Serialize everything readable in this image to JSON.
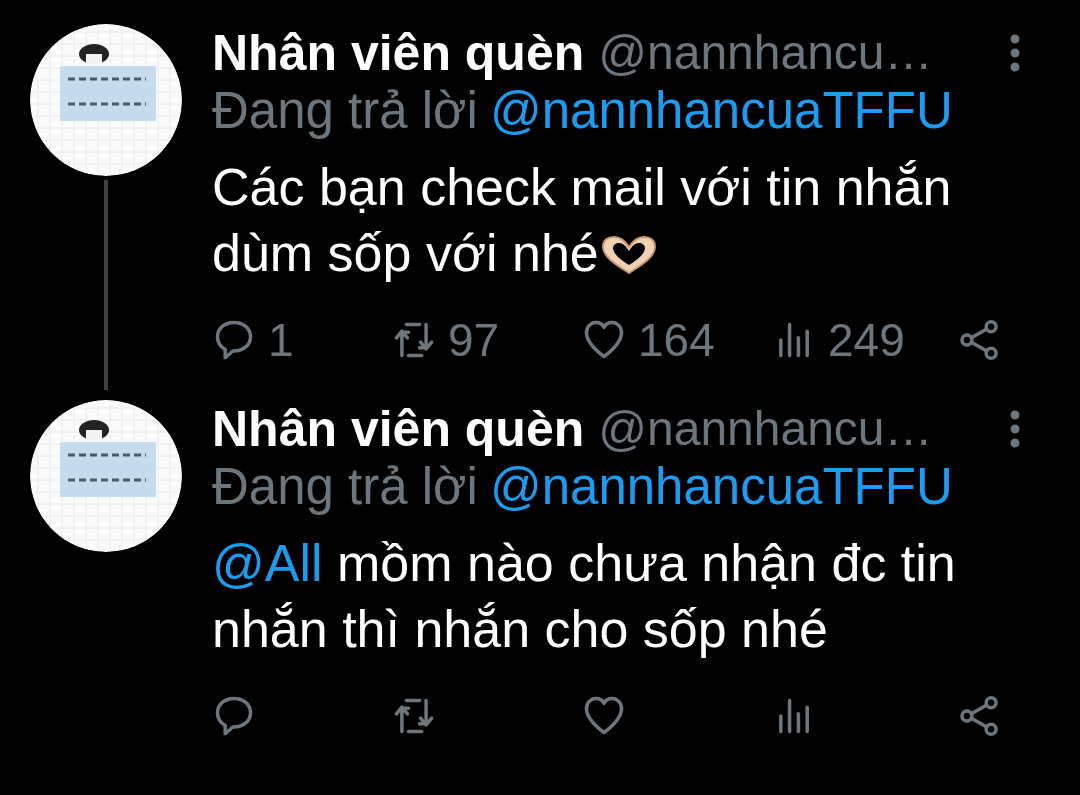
{
  "tweets": [
    {
      "name": "Nhân viên quèn",
      "handle": "@nannhancu…",
      "reply_prefix": "Đang trả lời",
      "reply_to": "@nannhancuaTFFU",
      "body": [
        {
          "kind": "text",
          "text": "Các bạn check mail với tin nhắn dùm sốp với nhé"
        }
      ],
      "heart_emoji": true,
      "thread_line": true,
      "actions": [
        {
          "kind": "reply",
          "count": "1"
        },
        {
          "kind": "retweet",
          "count": "97"
        },
        {
          "kind": "like",
          "count": "164"
        },
        {
          "kind": "views",
          "count": "249"
        },
        {
          "kind": "share"
        }
      ]
    },
    {
      "name": "Nhân viên quèn",
      "handle": "@nannhancu…",
      "reply_prefix": "Đang trả lời",
      "reply_to": "@nannhancuaTFFU",
      "body": [
        {
          "kind": "mention",
          "text": "@All"
        },
        {
          "kind": "text",
          "text": " mồm nào chưa nhận đc tin nhắn thì nhắn cho sốp nhé"
        }
      ],
      "thread_line": false,
      "actions": [
        {
          "kind": "reply"
        },
        {
          "kind": "retweet"
        },
        {
          "kind": "like"
        },
        {
          "kind": "views"
        },
        {
          "kind": "share"
        }
      ]
    }
  ]
}
